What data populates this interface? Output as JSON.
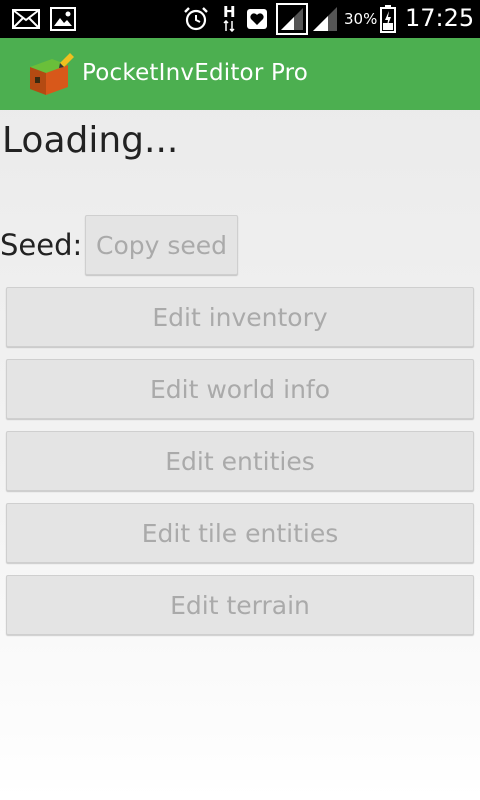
{
  "status_bar": {
    "battery_percent": "30%",
    "time": "17:25",
    "network_label": "H"
  },
  "app_bar": {
    "title": "PocketInvEditor Pro",
    "icon": "chest-icon"
  },
  "main": {
    "loading_text": "Loading...",
    "seed_label": "Seed:",
    "copy_seed_label": "Copy seed",
    "buttons": [
      {
        "label": "Edit inventory"
      },
      {
        "label": "Edit world info"
      },
      {
        "label": "Edit entities"
      },
      {
        "label": "Edit tile entities"
      },
      {
        "label": "Edit terrain"
      }
    ]
  },
  "colors": {
    "app_bar": "#4caf50",
    "button_bg": "#e4e4e4",
    "button_text_disabled": "#aaaaaa"
  }
}
